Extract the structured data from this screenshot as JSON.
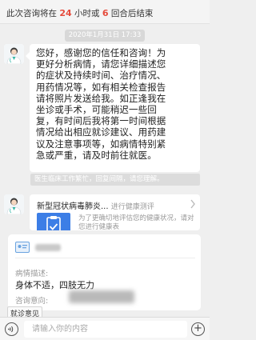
{
  "notice": {
    "prefix": "此次咨询将在",
    "hours": "24",
    "middle": "小时或",
    "rounds": "6",
    "suffix": "回合后结束"
  },
  "timestamp": "2020年1月31日 17:33",
  "doctor_message": {
    "lines": [
      "您好，感谢您的信任和咨询！为",
      "更好分析病情，请您详细描述您",
      "的症状及持续时间、治疗情况、",
      "用药情况等，如有相关检查报告",
      "请将照片发送给我。如正逢我在",
      "坐诊或手术，可能稍迟一些回",
      "复，有时间后我将第一时间根据",
      "情况给出相应就诊建议、用药建",
      "议及注意事项等，如病情特别紧",
      "急或严重，请及时前往就医。"
    ]
  },
  "meta_text": "医生临床工作繁忙，回复间隔，请您理解。",
  "card": {
    "title": "新型冠状病毒肺炎...",
    "subtitle": "进行健康测评",
    "description": "为了更确切地评估您的健康状况，请对您进行健康表"
  },
  "form": {
    "condition_label": "病情描述:",
    "condition_value": "身体不适，四肢无力",
    "intent_label": "咨询意向:",
    "intent_tag": "就诊意见"
  },
  "input_bar": {
    "placeholder": "请输入你的内容",
    "plus": "+"
  }
}
